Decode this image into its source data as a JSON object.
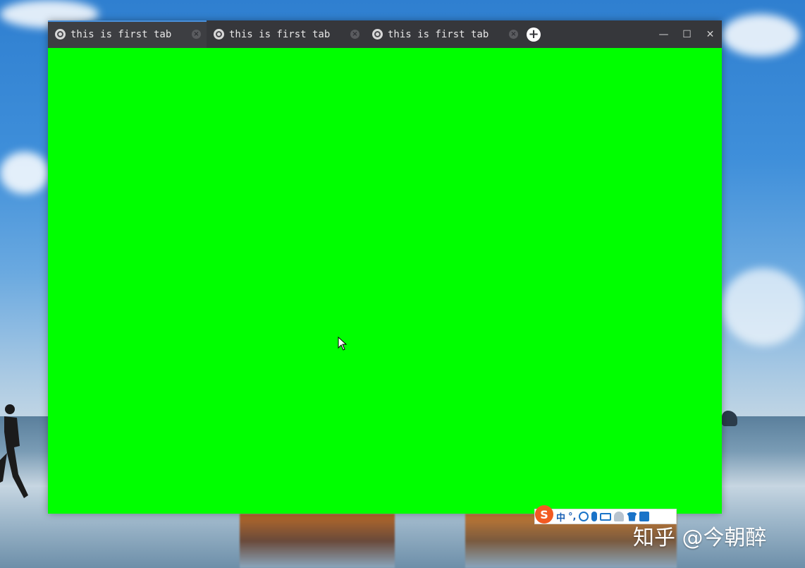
{
  "tabs": [
    {
      "title": "this is first tab",
      "close": "×"
    },
    {
      "title": "this is first tab",
      "close": "×"
    },
    {
      "title": "this is first tab",
      "close": "×"
    }
  ],
  "new_tab": "+",
  "window_controls": {
    "minimize": "—",
    "maximize": "☐",
    "close": "✕"
  },
  "content": {
    "background": "#00ff00"
  },
  "ime_toolbar": {
    "logo": "S",
    "items": [
      "中",
      "°,"
    ]
  },
  "watermark": "知乎 @今朝醉",
  "colors": {
    "titlebar": "#36373b",
    "accent": "#4a8fd8",
    "content": "#00ff00",
    "ime_logo": "#f25a22"
  }
}
